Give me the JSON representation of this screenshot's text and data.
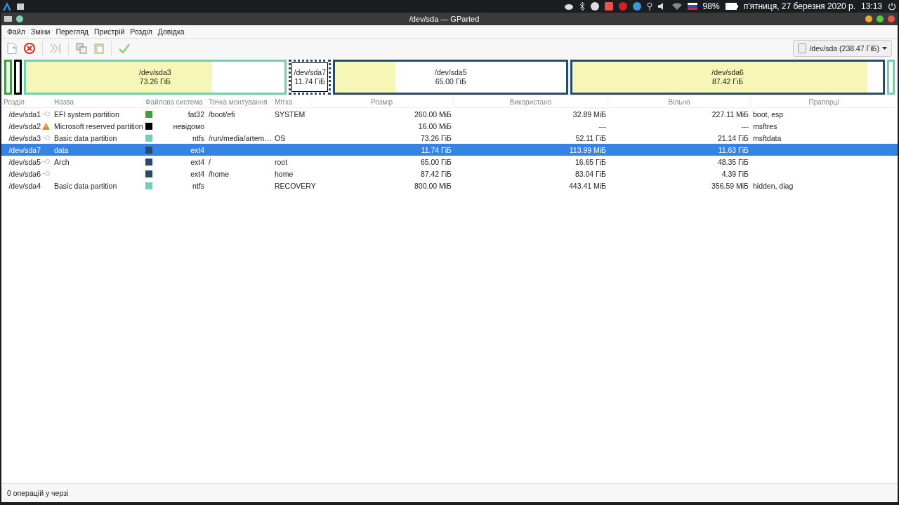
{
  "top_panel": {
    "battery": "98%",
    "date": "п'ятниця, 27 березня 2020 р.",
    "time": "13:13"
  },
  "window": {
    "title": "/dev/sda — GParted"
  },
  "menu": [
    "Файл",
    "Зміни",
    "Перегляд",
    "Пристрій",
    "Розділ",
    "Довідка"
  ],
  "device_selector": {
    "value": "/dev/sda (238.47 ГіБ)"
  },
  "disk_map": [
    {
      "color": "#3ea03e",
      "selected": false
    },
    {
      "color": "#000000",
      "selected": false
    },
    {
      "color": "#70d0b0",
      "level": 0.72,
      "selected": false,
      "name": "/dev/sda3",
      "size": "73.26 ГіБ"
    },
    {
      "color": "#2a4a6a",
      "selected": true,
      "name": "/dev/sda7",
      "size": "11.74 ГіБ"
    },
    {
      "color": "#2a4a6a",
      "level": 0.26,
      "selected": false,
      "name": "/dev/sda5",
      "size": "65.00 ГіБ"
    },
    {
      "color": "#2a4a6a",
      "level": 0.95,
      "selected": false,
      "name": "/dev/sda6",
      "size": "87.42 ГіБ"
    },
    {
      "color": "#70d0b0",
      "selected": false
    }
  ],
  "table": {
    "columns": [
      "Розділ",
      "Назва",
      "Файлова система",
      "Точка монтування",
      "Мітка",
      "Розмір",
      "Використано",
      "Вільно",
      "Прапорці"
    ],
    "rows": [
      {
        "partition": "/dev/sda1",
        "mounted": true,
        "warning": false,
        "name": "EFI system partition",
        "color": "#3ea03e",
        "fs": "fat32",
        "mount": "/boot/efi",
        "label": "SYSTEM",
        "size": "260.00 МіБ",
        "used": "32.89 МіБ",
        "free": "227.11 МіБ",
        "flags": "boot, esp",
        "selected": false
      },
      {
        "partition": "/dev/sda2",
        "mounted": false,
        "warning": true,
        "name": "Microsoft reserved partition",
        "color": "#000000",
        "fs": "невідомо",
        "size": "16.00 МіБ",
        "used": "---",
        "free": "---",
        "flags": "msftres",
        "selected": false
      },
      {
        "partition": "/dev/sda3",
        "mounted": true,
        "warning": false,
        "name": "Basic data partition",
        "color": "#70d0b0",
        "fs": "ntfs",
        "mount": "/run/media/artem…",
        "label": "OS",
        "size": "73.26 ГіБ",
        "used": "52.11 ГіБ",
        "free": "21.14 ГіБ",
        "flags": "msftdata",
        "selected": false
      },
      {
        "partition": "/dev/sda7",
        "mounted": false,
        "warning": false,
        "name": "data",
        "color": "#2a4a6a",
        "fs": "ext4",
        "size": "11.74 ГіБ",
        "used": "113.99 МіБ",
        "free": "11.63 ГіБ",
        "selected": true
      },
      {
        "partition": "/dev/sda5",
        "mounted": true,
        "warning": false,
        "name": "Arch",
        "color": "#2a4a6a",
        "fs": "ext4",
        "mount": "/",
        "label": "root",
        "size": "65.00 ГіБ",
        "used": "16.65 ГіБ",
        "free": "48.35 ГіБ",
        "selected": false
      },
      {
        "partition": "/dev/sda6",
        "mounted": true,
        "warning": false,
        "color": "#2a4a6a",
        "fs": "ext4",
        "mount": "/home",
        "label": "home",
        "size": "87.42 ГіБ",
        "used": "83.04 ГіБ",
        "free": "4.39 ГіБ",
        "selected": false
      },
      {
        "partition": "/dev/sda4",
        "mounted": false,
        "warning": false,
        "name": "Basic data partition",
        "color": "#70d0b0",
        "fs": "ntfs",
        "label": "RECOVERY",
        "size": "800.00 МіБ",
        "used": "443.41 МіБ",
        "free": "356.59 МіБ",
        "flags": "hidden, diag",
        "selected": false
      }
    ]
  },
  "status_bar": "0 операцій у черзі"
}
